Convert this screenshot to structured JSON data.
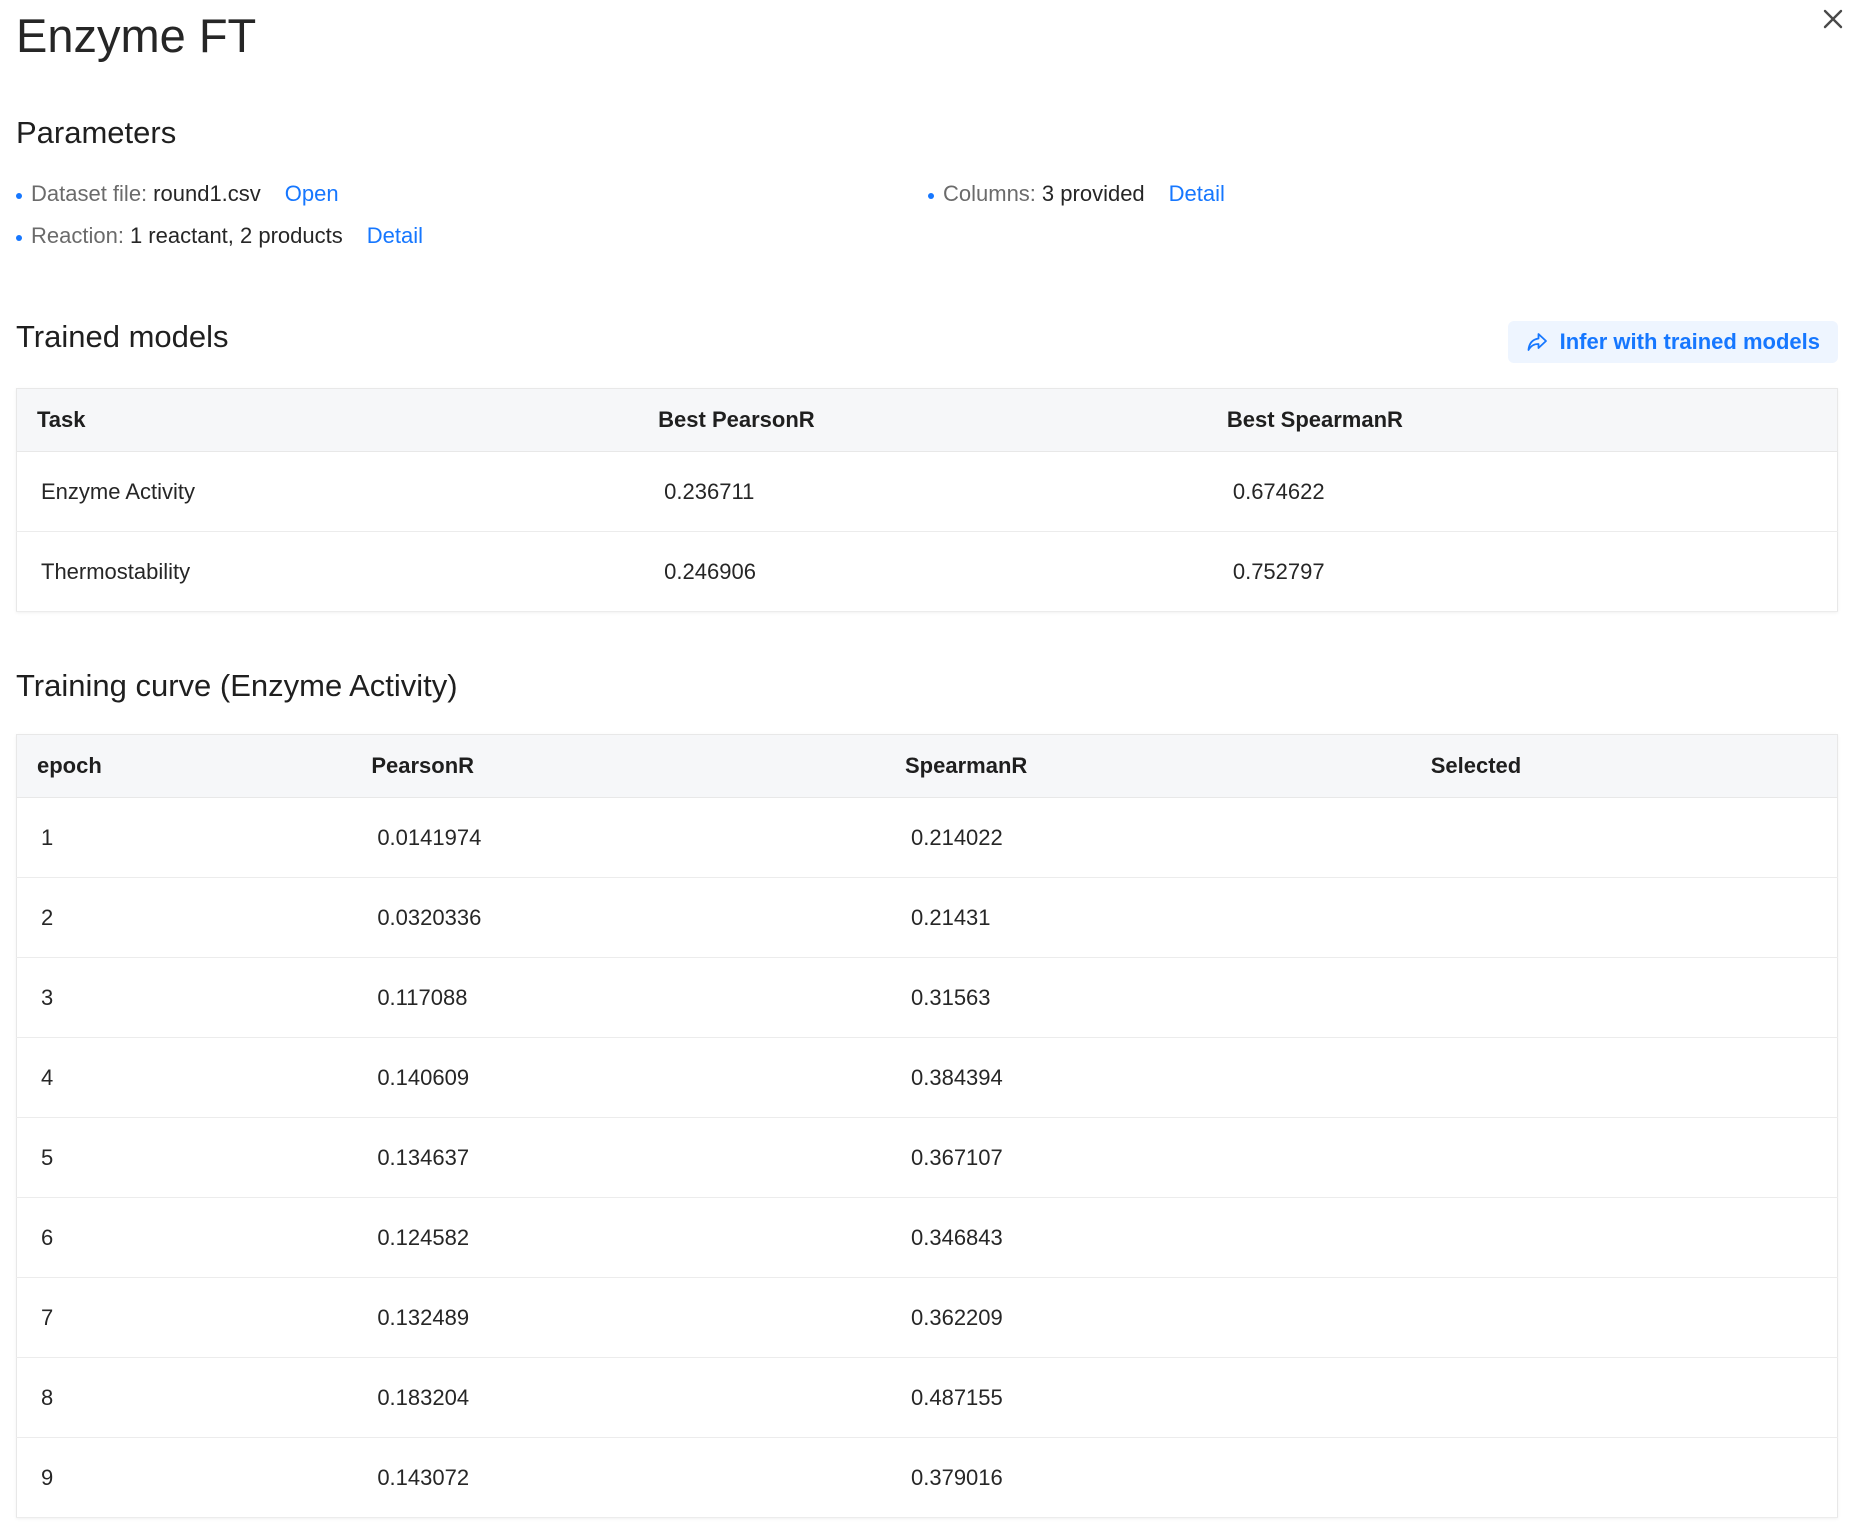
{
  "window": {
    "title": "Enzyme FT",
    "close_icon": "close-icon"
  },
  "parameters": {
    "heading": "Parameters",
    "dataset": {
      "label": "Dataset file:",
      "value": "round1.csv",
      "link": "Open"
    },
    "columns": {
      "label": "Columns:",
      "value": "3 provided",
      "link": "Detail"
    },
    "reaction": {
      "label": "Reaction:",
      "value": "1 reactant, 2 products",
      "link": "Detail"
    }
  },
  "trained_models": {
    "heading": "Trained models",
    "infer_button": {
      "label": "Infer with trained models",
      "icon": "share-arrow-icon"
    },
    "columns": [
      "Task",
      "Best PearsonR",
      "Best SpearmanR"
    ],
    "rows": [
      [
        "Enzyme Activity",
        "0.236711",
        "0.674622"
      ],
      [
        "Thermostability",
        "0.246906",
        "0.752797"
      ]
    ]
  },
  "training_curve": {
    "heading": "Training curve (Enzyme Activity)",
    "columns": [
      "epoch",
      "PearsonR",
      "SpearmanR",
      "Selected"
    ],
    "rows": [
      [
        "1",
        "0.0141974",
        "0.214022",
        ""
      ],
      [
        "2",
        "0.0320336",
        "0.21431",
        ""
      ],
      [
        "3",
        "0.117088",
        "0.31563",
        ""
      ],
      [
        "4",
        "0.140609",
        "0.384394",
        ""
      ],
      [
        "5",
        "0.134637",
        "0.367107",
        ""
      ],
      [
        "6",
        "0.124582",
        "0.346843",
        ""
      ],
      [
        "7",
        "0.132489",
        "0.362209",
        ""
      ],
      [
        "8",
        "0.183204",
        "0.487155",
        ""
      ],
      [
        "9",
        "0.143072",
        "0.379016",
        ""
      ]
    ]
  },
  "colors": {
    "accent": "#1677ff",
    "header_bg": "#f6f7f9",
    "button_bg": "#eef5ff"
  }
}
